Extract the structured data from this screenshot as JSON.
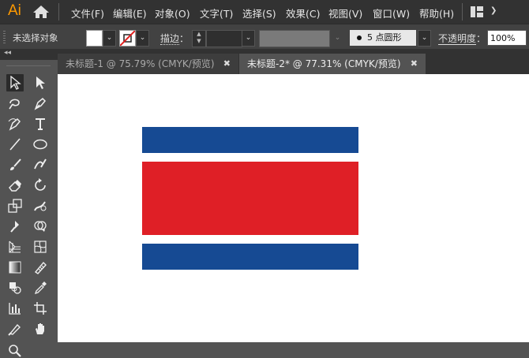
{
  "app": {
    "logo": "Ai"
  },
  "menu": [
    "文件(F)",
    "编辑(E)",
    "对象(O)",
    "文字(T)",
    "选择(S)",
    "效果(C)",
    "视图(V)",
    "窗口(W)",
    "帮助(H)"
  ],
  "control_bar": {
    "selection_status": "未选择对象",
    "stroke_label": "描边",
    "stroke_colon": "：",
    "brush_label": "5 点圆形",
    "opacity_label": "不透明度",
    "opacity_colon": "：",
    "opacity_value": "100%"
  },
  "tabs": [
    {
      "title": "未标题-1 @ 75.79% (CMYK/预览)",
      "close": "✖",
      "active": false
    },
    {
      "title": "未标题-2* @ 77.31% (CMYK/预览)",
      "close": "✖",
      "active": true
    }
  ],
  "colors": {
    "fill": "#ffffff",
    "flag_blue": "#164a93",
    "flag_red": "#df1f26",
    "canvas": "#ffffff"
  },
  "tools": [
    "selection-tool",
    "direct-selection-tool",
    "magic-wand-tool",
    "pen-tool",
    "curvature-tool",
    "type-tool",
    "line-segment-tool",
    "ellipse-tool",
    "paintbrush-tool",
    "shaper-tool",
    "eraser-tool",
    "rotate-tool",
    "scale-tool",
    "warp-tool",
    "puppet-warp-tool",
    "shape-builder-tool",
    "perspective-grid-tool",
    "mesh-tool",
    "gradient-tool",
    "eyedropper-measure-tool",
    "blend-tool",
    "eyedropper-tool",
    "column-graph-tool",
    "artboard-tool",
    "slice-tool",
    "hand-tool",
    "zoom-tool"
  ]
}
